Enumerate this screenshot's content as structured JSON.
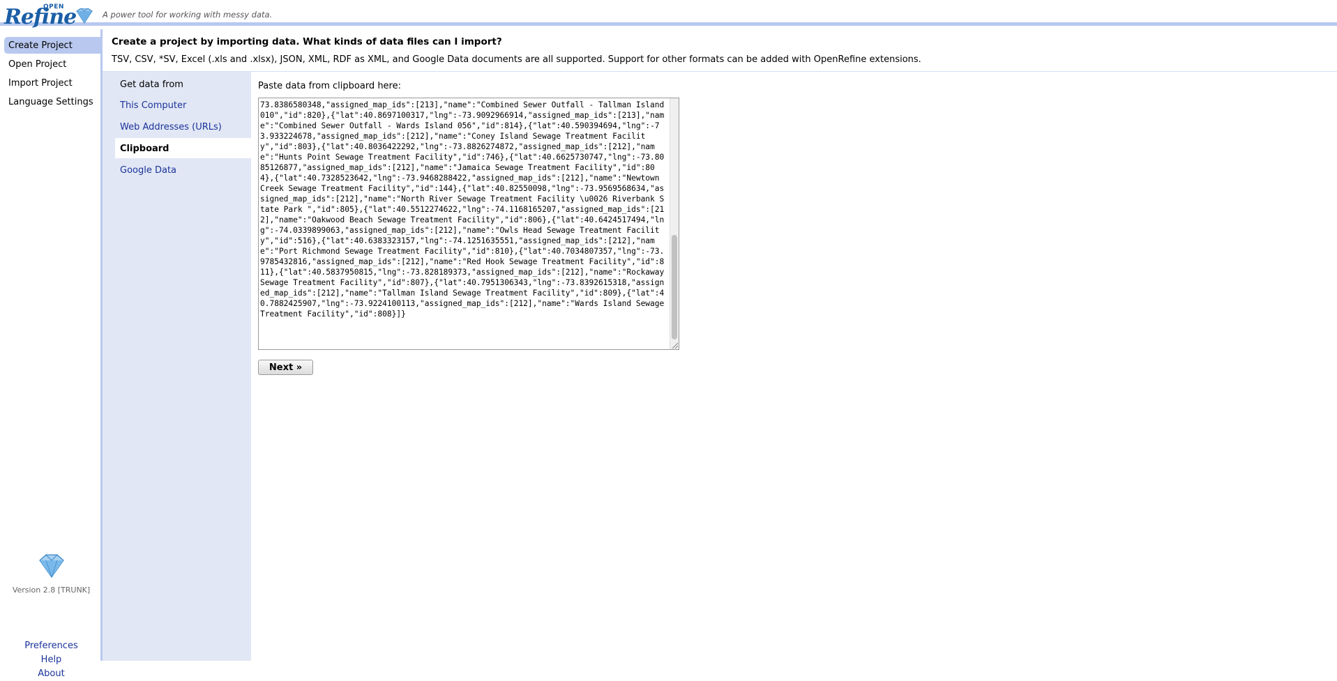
{
  "header": {
    "logo_text": "Refine",
    "logo_open": "OPEN",
    "slogan": "A power tool for working with messy data."
  },
  "left_panel": {
    "tabs": [
      {
        "label": "Create Project",
        "selected": true
      },
      {
        "label": "Open Project",
        "selected": false
      },
      {
        "label": "Import Project",
        "selected": false
      },
      {
        "label": "Language Settings",
        "selected": false
      }
    ],
    "version": "Version 2.8 [TRUNK]",
    "links": [
      "Preferences",
      "Help",
      "About"
    ]
  },
  "main": {
    "title": "Create a project by importing data. What kinds of data files can I import?",
    "description": "TSV, CSV, *SV, Excel (.xls and .xlsx), JSON, XML, RDF as XML, and Google Data documents are all supported. Support for other formats can be added with OpenRefine extensions.",
    "source_heading": "Get data from",
    "sources": [
      {
        "label": "This Computer",
        "selected": false
      },
      {
        "label": "Web Addresses (URLs)",
        "selected": false
      },
      {
        "label": "Clipboard",
        "selected": true
      },
      {
        "label": "Google Data",
        "selected": false
      }
    ],
    "clipboard_label": "Paste data from clipboard here:",
    "clipboard_text": "73.8386580348,\"assigned_map_ids\":[213],\"name\":\"Combined Sewer Outfall - Tallman Island 010\",\"id\":820},{\"lat\":40.8697100317,\"lng\":-73.9092966914,\"assigned_map_ids\":[213],\"name\":\"Combined Sewer Outfall - Wards Island 056\",\"id\":814},{\"lat\":40.590394694,\"lng\":-73.933224678,\"assigned_map_ids\":[212],\"name\":\"Coney Island Sewage Treatment Facility\",\"id\":803},{\"lat\":40.8036422292,\"lng\":-73.8826274872,\"assigned_map_ids\":[212],\"name\":\"Hunts Point Sewage Treatment Facility\",\"id\":746},{\"lat\":40.6625730747,\"lng\":-73.8085126877,\"assigned_map_ids\":[212],\"name\":\"Jamaica Sewage Treatment Facility\",\"id\":804},{\"lat\":40.7328523642,\"lng\":-73.9468288422,\"assigned_map_ids\":[212],\"name\":\"Newtown Creek Sewage Treatment Facility\",\"id\":144},{\"lat\":40.82550098,\"lng\":-73.9569568634,\"assigned_map_ids\":[212],\"name\":\"North River Sewage Treatment Facility \\u0026 Riverbank State Park \",\"id\":805},{\"lat\":40.5512274622,\"lng\":-74.1168165207,\"assigned_map_ids\":[212],\"name\":\"Oakwood Beach Sewage Treatment Facility\",\"id\":806},{\"lat\":40.6424517494,\"lng\":-74.0339899063,\"assigned_map_ids\":[212],\"name\":\"Owls Head Sewage Treatment Facility\",\"id\":516},{\"lat\":40.6383323157,\"lng\":-74.1251635551,\"assigned_map_ids\":[212],\"name\":\"Port Richmond Sewage Treatment Facility\",\"id\":810},{\"lat\":40.7034807357,\"lng\":-73.9785432816,\"assigned_map_ids\":[212],\"name\":\"Red Hook Sewage Treatment Facility\",\"id\":811},{\"lat\":40.5837950815,\"lng\":-73.828189373,\"assigned_map_ids\":[212],\"name\":\"Rockaway Sewage Treatment Facility\",\"id\":807},{\"lat\":40.7951306343,\"lng\":-73.8392615318,\"assigned_map_ids\":[212],\"name\":\"Tallman Island Sewage Treatment Facility\",\"id\":809},{\"lat\":40.7882425907,\"lng\":-73.9224100113,\"assigned_map_ids\":[212],\"name\":\"Wards Island Sewage Treatment Facility\",\"id\":808}]}",
    "next_label": "Next »"
  },
  "colors": {
    "accent": "#b8c8ef",
    "source_bg": "#e2e7f5",
    "link": "#1a3399",
    "logo": "#1b5ea6"
  }
}
